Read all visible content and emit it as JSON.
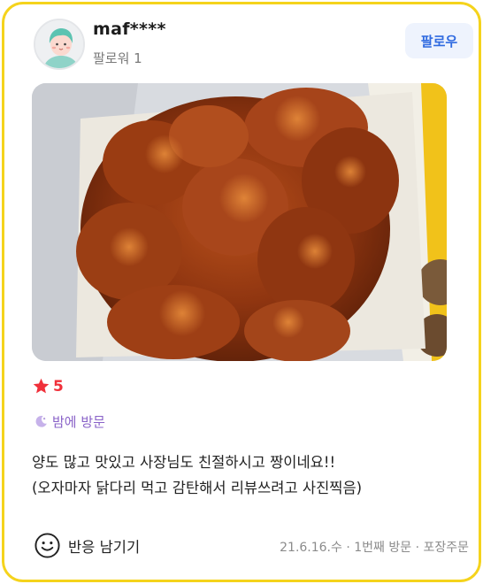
{
  "user": {
    "name": "maf****",
    "followers": "팔로워 1"
  },
  "follow_button": {
    "label": "팔로우"
  },
  "photo": {
    "subject": "fried-chicken-photo"
  },
  "rating": {
    "value": "5"
  },
  "visit_tag": {
    "label": "밤에 방문"
  },
  "review": {
    "lines": [
      "양도 많고 맛있고 사장님도 친절하시고 짱이네요!!",
      "(오자마자 닭다리 먹고 감탄해서 리뷰쓰려고 사진찍음)"
    ]
  },
  "reaction_button": {
    "label": "반응 남기기"
  },
  "meta": {
    "text": "21.6.16.수 · 1번째 방문 · 포장주문"
  },
  "colors": {
    "card_border": "#f5d31c",
    "follow_text": "#2f6ae0",
    "star": "#f0303a",
    "visit": "#8a63c8"
  }
}
